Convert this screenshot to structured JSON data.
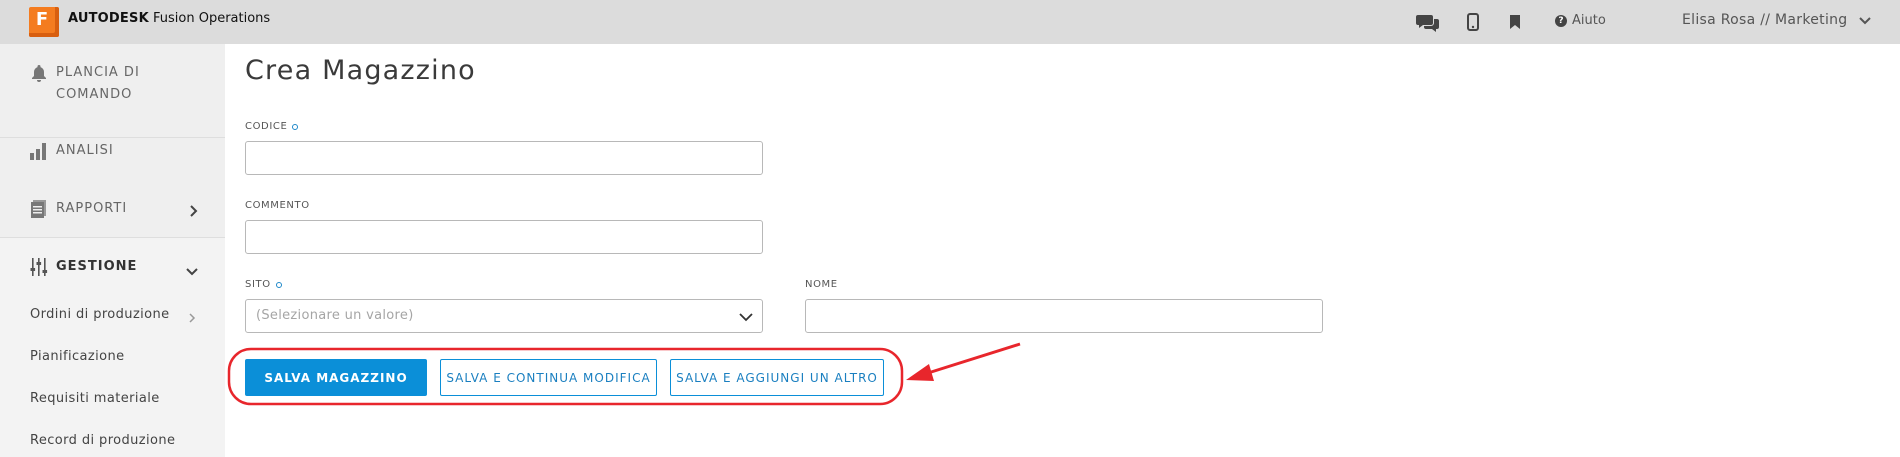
{
  "topbar": {
    "logo_letter": "F",
    "brand_bold": "AUTODESK",
    "brand_product": "Fusion Operations",
    "help_label": "Aiuto",
    "user_label": "Elisa Rosa // Marketing"
  },
  "sidebar": {
    "items": [
      {
        "label": "PLANCIA DI COMANDO",
        "icon": "bell-icon"
      },
      {
        "label": "ANALISI",
        "icon": "bar-chart-icon"
      },
      {
        "label": "RAPPORTI",
        "icon": "report-icon"
      },
      {
        "label": "GESTIONE",
        "icon": "sliders-icon"
      }
    ],
    "sub_items": [
      {
        "label": "Ordini di produzione"
      },
      {
        "label": "Pianificazione"
      },
      {
        "label": "Requisiti materiale"
      },
      {
        "label": "Record di produzione"
      }
    ]
  },
  "form": {
    "title": "Crea Magazzino",
    "codice_label": "CODICE",
    "codice_value": "",
    "commento_label": "COMMENTO",
    "commento_value": "",
    "sito_label": "SITO",
    "sito_placeholder": "(Selezionare un valore)",
    "nome_label": "NOME",
    "nome_value": ""
  },
  "actions": {
    "save_label": "SALVA MAGAZZINO",
    "save_continue_label": "SALVA E CONTINUA MODIFICA",
    "save_add_label": "SALVA E AGGIUNGI UN ALTRO"
  },
  "colors": {
    "accent": "#0b8fd8",
    "brand": "#f47c20",
    "annotation": "#e8262c"
  }
}
